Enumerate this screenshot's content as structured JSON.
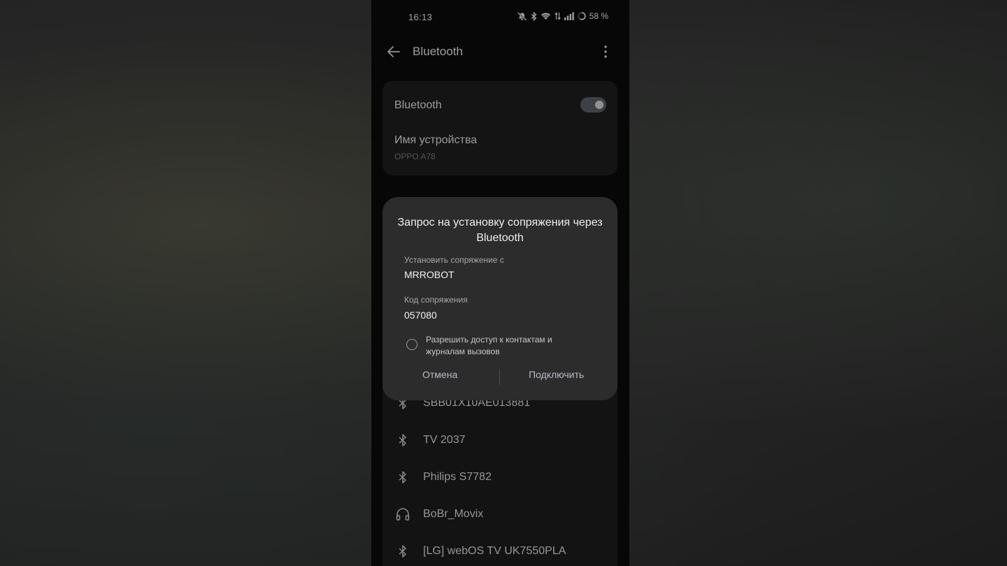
{
  "status_bar": {
    "time": "16:13",
    "battery": "58 %",
    "icons": [
      "mute-vibrate-icon",
      "bluetooth-icon",
      "wifi-icon",
      "data-roaming-icon",
      "signal-icon",
      "battery-icon"
    ]
  },
  "app_bar": {
    "title": "Bluetooth",
    "back_icon": "arrow-left-icon",
    "menu_icon": "more-vert-icon"
  },
  "settings": {
    "bluetooth_label": "Bluetooth",
    "bluetooth_enabled": true,
    "device_name_label": "Имя устройства",
    "device_name_value": "OPPO A78"
  },
  "dialog": {
    "title": "Запрос на установку сопряжения через Bluetooth",
    "pair_with_label": "Установить сопряжение с",
    "pair_with_value": "MRROBOT",
    "code_label": "Код сопряжения",
    "code_value": "057080",
    "allow_access_label": "Разрешить доступ к контактам и журналам вызовов",
    "allow_access_checked": false,
    "cancel_label": "Отмена",
    "connect_label": "Подключить"
  },
  "devices": [
    {
      "name": "SBB01X10AE013881",
      "icon": "bluetooth-icon"
    },
    {
      "name": "TV 2037",
      "icon": "bluetooth-icon"
    },
    {
      "name": "Philips S7782",
      "icon": "bluetooth-icon"
    },
    {
      "name": "BoBr_Movix",
      "icon": "headphones-icon"
    },
    {
      "name": "[LG] webOS TV UK7550PLA",
      "icon": "bluetooth-icon"
    }
  ],
  "colors": {
    "background": "#0b0b0b",
    "card": "#1e1e1e",
    "dialog": "#2c2c2c",
    "toggle_on": "#5a5f66",
    "button_text": "#b8bcc4"
  }
}
